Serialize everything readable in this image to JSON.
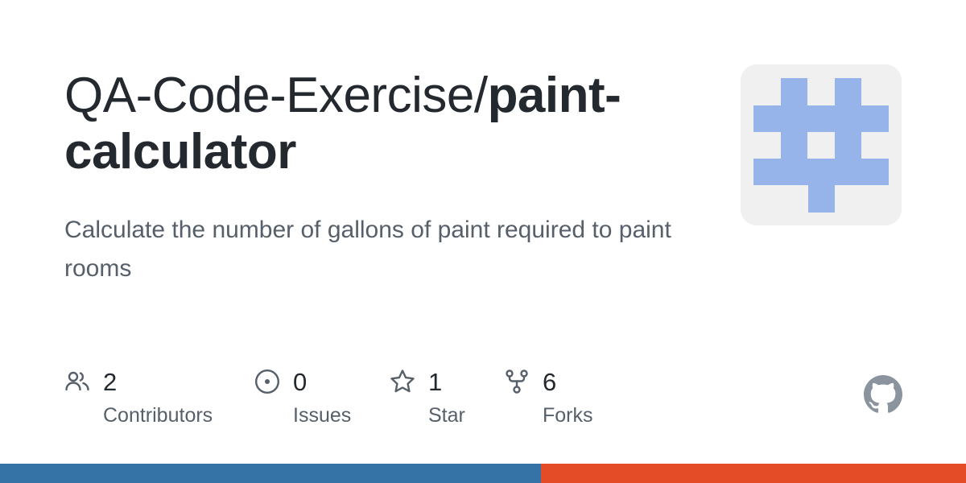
{
  "repo": {
    "owner_prefix": "QA-Code-Exercise/",
    "name": "paint-calculator",
    "description": "Calculate the number of gallons of paint required to paint rooms"
  },
  "avatar": {
    "icon": "identicon",
    "color": "#97b4ea",
    "background": "#f0f0f0"
  },
  "stats": [
    {
      "icon": "people-icon",
      "value": "2",
      "label": "Contributors"
    },
    {
      "icon": "issue-opened-icon",
      "value": "0",
      "label": "Issues"
    },
    {
      "icon": "star-icon",
      "value": "1",
      "label": "Star"
    },
    {
      "icon": "repo-forked-icon",
      "value": "6",
      "label": "Forks"
    }
  ],
  "logo": {
    "icon": "github-mark-icon",
    "color": "#8b949e"
  },
  "languages": [
    {
      "share": 0.56,
      "color": "#3572a5"
    },
    {
      "share": 0.44,
      "color": "#e34c26"
    }
  ]
}
